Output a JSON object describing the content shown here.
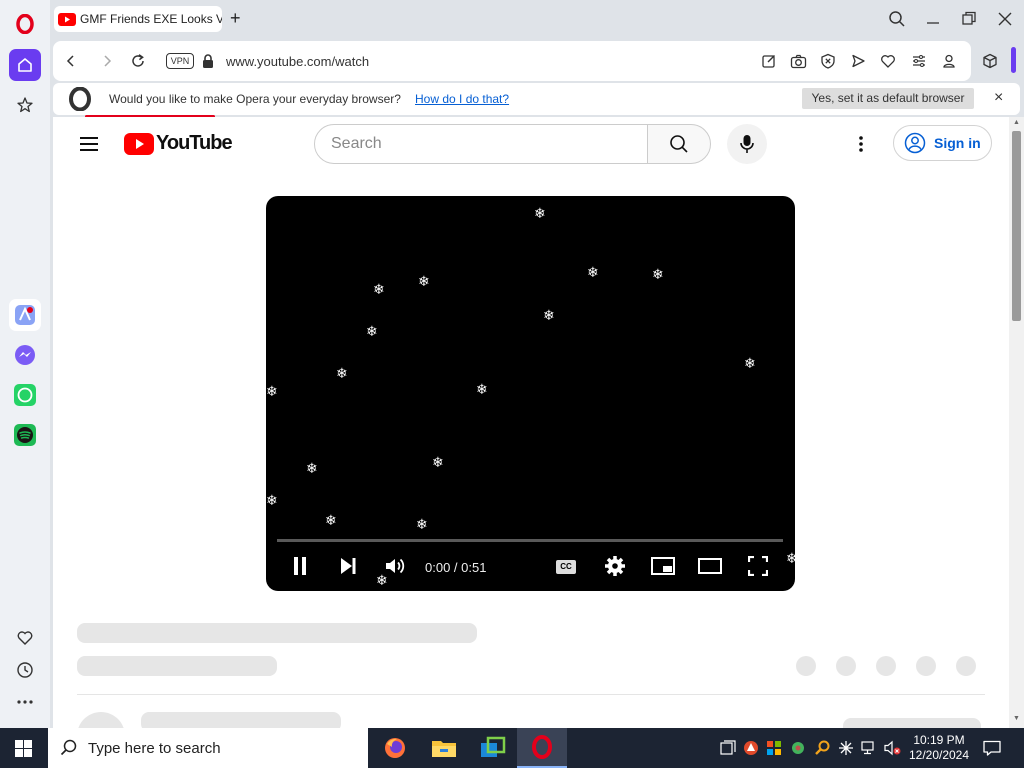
{
  "browser": {
    "tab_title": "GMF Friends EXE Looks Vi",
    "new_tab_label": "+",
    "url": "www.youtube.com/watch",
    "vpn_label": "VPN"
  },
  "notice": {
    "message": "Would you like to make Opera your everyday browser?",
    "link": "How do I do that?",
    "button": "Yes, set it as default browser",
    "close": "×"
  },
  "youtube": {
    "logo_text": "YouTube",
    "search_placeholder": "Search",
    "sign_in": "Sign in"
  },
  "player": {
    "time": "0:00 / 0:51",
    "cc_label": "CC",
    "progress": 0.0
  },
  "taskbar": {
    "search_placeholder": "Type here to search",
    "time": "10:19 PM",
    "date": "12/20/2024"
  },
  "colors": {
    "opera_red": "#e3001b",
    "youtube_red": "#ff0000",
    "sidebar_active": "#6a3cf0",
    "link_blue": "#065fd4"
  }
}
